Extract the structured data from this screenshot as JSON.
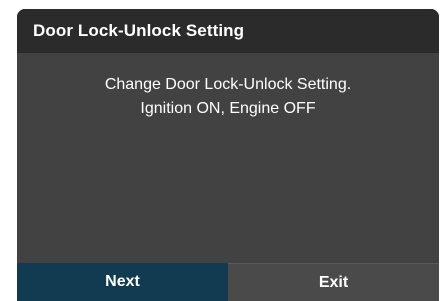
{
  "dialog": {
    "title": "Door Lock-Unlock Setting",
    "message_line1": "Change Door Lock-Unlock Setting.",
    "message_line2": "Ignition ON, Engine OFF",
    "buttons": {
      "next_label": "Next",
      "exit_label": "Exit"
    }
  },
  "colors": {
    "dialog_background": "#424242",
    "title_bar_background": "#2b2b2b",
    "next_button_background": "#123a50",
    "exit_button_background": "#4a4a4a",
    "text": "#ffffff"
  }
}
